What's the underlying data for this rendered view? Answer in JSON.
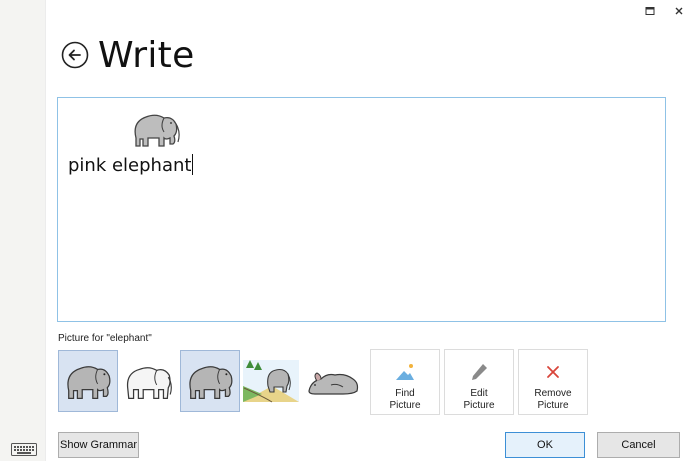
{
  "window": {
    "title": "Write",
    "maximize_icon": "maximize-icon",
    "close_icon": "close-icon"
  },
  "editor": {
    "text": "pink elephant",
    "symbol_icon": "elephant-symbol"
  },
  "picture_picker": {
    "label": "Picture for \"elephant\"",
    "options": [
      {
        "icon": "elephant-symbol-1",
        "selected": true
      },
      {
        "icon": "elephant-symbol-2",
        "selected": false
      },
      {
        "icon": "elephant-symbol-3",
        "selected": true
      },
      {
        "icon": "elephant-scene-symbol",
        "selected": false
      },
      {
        "icon": "lying-animal-symbol",
        "selected": false
      }
    ]
  },
  "actions": {
    "find_picture_line1": "Find",
    "find_picture_line2": "Picture",
    "edit_picture_line1": "Edit",
    "edit_picture_line2": "Picture",
    "remove_picture_line1": "Remove",
    "remove_picture_line2": "Picture"
  },
  "footer": {
    "show_grammar": "Show Grammar",
    "ok": "OK",
    "cancel": "Cancel"
  },
  "colors": {
    "accent_border": "#8fc2e6",
    "selected_bg": "#d8e3f2",
    "remove_red": "#d9453a",
    "find_blue": "#6aaee0",
    "find_yellow": "#f2b33d"
  }
}
